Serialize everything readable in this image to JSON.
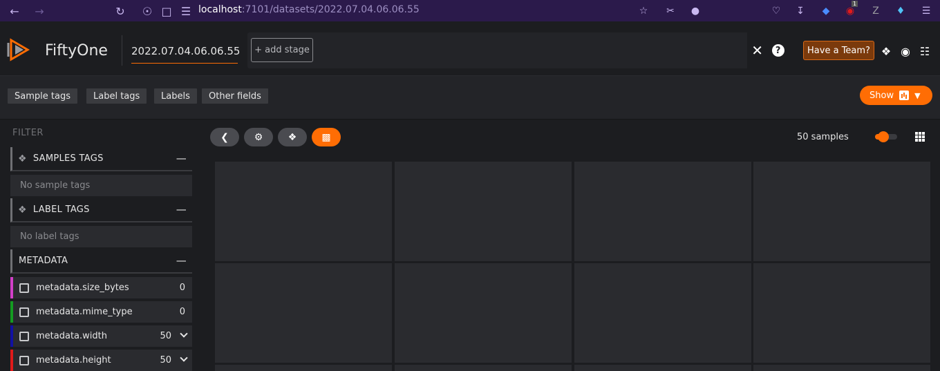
{
  "browser": {
    "url_host": "localhost",
    "url_path": ":7101/datasets/2022.07.04.06.06.55",
    "ext_badge": "1"
  },
  "app": {
    "brand": "FiftyOne",
    "dataset": "2022.07.04.06.06.55",
    "add_stage": "+ add stage",
    "team_button": "Have a Team?"
  },
  "fields_bar": {
    "buttons": [
      "Sample tags",
      "Label tags",
      "Labels",
      "Other fields"
    ],
    "show": "Show"
  },
  "sidebar": {
    "filter_title": "FILTER",
    "groups": [
      {
        "title": "SAMPLES TAGS",
        "empty": "No sample tags"
      },
      {
        "title": "LABEL TAGS",
        "empty": "No label tags"
      },
      {
        "title": "METADATA"
      }
    ],
    "metadata_fields": [
      {
        "name": "metadata.size_bytes",
        "count": "0",
        "color": "#d13fc7"
      },
      {
        "name": "metadata.mime_type",
        "count": "0",
        "color": "#149b21"
      },
      {
        "name": "metadata.width",
        "count": "50",
        "color": "#1111a3"
      },
      {
        "name": "metadata.height",
        "count": "50",
        "color": "#e01a1a"
      }
    ]
  },
  "main": {
    "samples_count": "50 samples"
  },
  "colors": {
    "accent": "#ff6d04",
    "background": "#1c1d20",
    "tile": "#2a2b2f"
  }
}
